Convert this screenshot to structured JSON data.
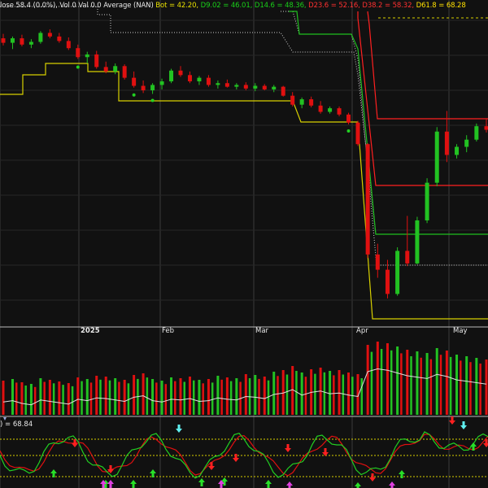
{
  "header": {
    "close_text": "lose 58.4 (0.0%),",
    "vol_text": "Vol 0",
    "val_text": "Val 0.0",
    "avg_text": "Average (NAN)",
    "bot": "Bot = 42.20,",
    "d9": "D9.02 = 46.01,",
    "d14": "D14.6 = 48.36,",
    "d23": "D23.6 = 52.16,",
    "d38": "D38.2 = 58.32,",
    "d61": "D61.8 = 68.28",
    "colors": {
      "bot": "#e8e000",
      "d9": "#19d219",
      "d14": "#19d219",
      "d23": "#ff3030",
      "d38": "#ff3030",
      "d61": "#ffe000"
    }
  },
  "oscillator": {
    "label": ") = 68.84"
  },
  "chart_data": {
    "type": "candlestick",
    "months": [
      "2025",
      "Feb",
      "Mar",
      "Apr",
      "May"
    ],
    "panels": [
      "price",
      "volume",
      "oscillator"
    ],
    "colors": {
      "up": "#22c222",
      "down": "#e01010",
      "grid": "#3a3a3a",
      "yellow_line": "#d8d000",
      "green_line": "#1fbf1f",
      "red_line": "#ff2020",
      "dashed_yellow": "#d8d000",
      "osc_green": "#22d022",
      "osc_red": "#e01010",
      "arrow_green": "#28e028",
      "arrow_red": "#ff2020",
      "arrow_magenta": "#e040e0",
      "arrow_cyan": "#60f0f0"
    },
    "candles": [
      [
        50.0,
        50.5,
        49.2,
        49.5
      ],
      [
        49.5,
        50.2,
        48.8,
        50.0
      ],
      [
        50.0,
        50.4,
        49.1,
        49.3
      ],
      [
        49.3,
        49.9,
        48.9,
        49.6
      ],
      [
        49.6,
        50.8,
        49.4,
        50.6
      ],
      [
        50.6,
        51.0,
        50.0,
        50.2
      ],
      [
        50.2,
        50.6,
        49.5,
        49.7
      ],
      [
        49.7,
        50.1,
        48.7,
        48.9
      ],
      [
        48.9,
        49.3,
        47.7,
        47.9
      ],
      [
        47.9,
        48.5,
        47.2,
        48.2
      ],
      [
        48.2,
        48.6,
        46.6,
        46.8
      ],
      [
        46.8,
        47.4,
        46.1,
        46.3
      ],
      [
        46.3,
        47.2,
        46.0,
        46.9
      ],
      [
        46.9,
        47.1,
        45.4,
        45.6
      ],
      [
        45.6,
        46.3,
        44.5,
        44.7
      ],
      [
        44.7,
        45.3,
        43.9,
        44.2
      ],
      [
        44.2,
        45.0,
        43.8,
        44.8
      ],
      [
        44.8,
        45.5,
        44.3,
        45.2
      ],
      [
        45.2,
        46.6,
        45.0,
        46.4
      ],
      [
        46.4,
        46.9,
        45.7,
        45.9
      ],
      [
        45.9,
        46.3,
        45.0,
        45.2
      ],
      [
        45.2,
        45.8,
        44.8,
        45.6
      ],
      [
        45.6,
        45.9,
        44.6,
        44.8
      ],
      [
        44.8,
        45.3,
        44.4,
        45.0
      ],
      [
        45.0,
        45.4,
        44.5,
        44.6
      ],
      [
        44.6,
        45.0,
        44.3,
        44.8
      ],
      [
        44.8,
        45.1,
        44.2,
        44.4
      ],
      [
        44.4,
        45.0,
        44.1,
        44.7
      ],
      [
        44.7,
        44.9,
        44.2,
        44.3
      ],
      [
        44.3,
        44.8,
        44.0,
        44.6
      ],
      [
        44.6,
        44.7,
        43.5,
        43.6
      ],
      [
        43.6,
        44.0,
        42.4,
        42.6
      ],
      [
        42.6,
        43.4,
        42.2,
        43.2
      ],
      [
        43.2,
        43.5,
        42.3,
        42.5
      ],
      [
        42.5,
        43.0,
        41.6,
        41.8
      ],
      [
        41.8,
        42.4,
        41.6,
        42.2
      ],
      [
        42.2,
        42.4,
        41.3,
        41.5
      ],
      [
        41.5,
        41.7,
        40.4,
        40.6
      ],
      [
        40.6,
        40.8,
        38.0,
        38.2
      ],
      [
        38.2,
        38.3,
        25.5,
        25.9
      ],
      [
        25.9,
        27.1,
        23.3,
        24.2
      ],
      [
        24.2,
        25.3,
        21.0,
        21.5
      ],
      [
        21.5,
        26.7,
        21.3,
        26.3
      ],
      [
        26.3,
        30.2,
        24.6,
        24.9
      ],
      [
        24.9,
        30.1,
        24.8,
        29.7
      ],
      [
        29.7,
        34.4,
        29.4,
        33.9
      ],
      [
        33.9,
        40.1,
        33.5,
        39.6
      ],
      [
        39.6,
        41.9,
        36.2,
        37.0
      ],
      [
        37.0,
        38.2,
        36.6,
        37.9
      ],
      [
        37.9,
        39.2,
        37.3,
        38.7
      ],
      [
        38.7,
        40.5,
        38.5,
        40.2
      ],
      [
        40.2,
        41.0,
        39.5,
        39.8
      ]
    ],
    "volume": [
      0.42,
      0.44,
      0.4,
      0.38,
      0.45,
      0.43,
      0.41,
      0.39,
      0.46,
      0.44,
      0.48,
      0.47,
      0.45,
      0.43,
      0.49,
      0.51,
      0.44,
      0.42,
      0.46,
      0.45,
      0.47,
      0.43,
      0.44,
      0.48,
      0.46,
      0.45,
      0.5,
      0.49,
      0.47,
      0.53,
      0.55,
      0.6,
      0.52,
      0.56,
      0.58,
      0.54,
      0.55,
      0.52,
      0.5,
      0.86,
      0.9,
      0.88,
      0.84,
      0.8,
      0.78,
      0.76,
      0.82,
      0.79,
      0.74,
      0.72,
      0.7,
      0.68
    ],
    "levels_price": {
      "bot": 21.0,
      "d9": 25.5,
      "d14": 28.0,
      "d23": 33.0,
      "d38": 38.0,
      "d61": 45.0
    }
  }
}
